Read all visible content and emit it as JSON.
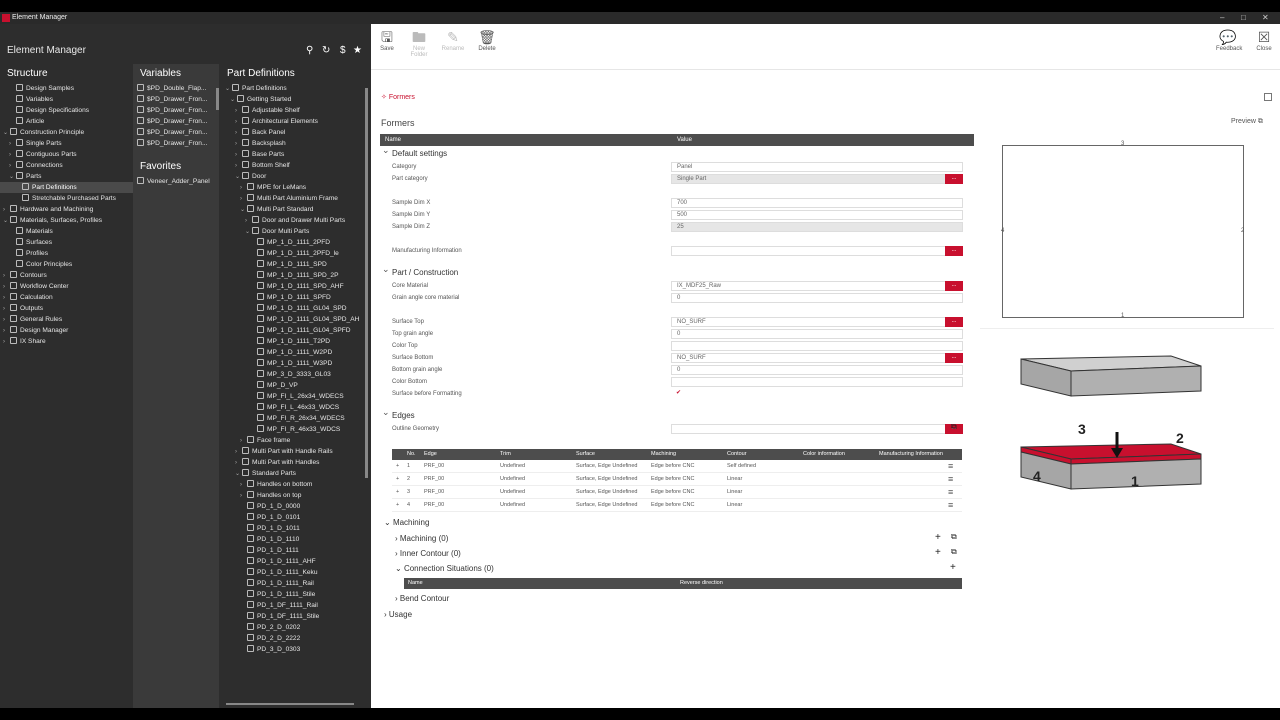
{
  "window": {
    "title": "Element Manager"
  },
  "app": {
    "title": "Element Manager"
  },
  "structure": {
    "title": "Structure",
    "items": [
      {
        "label": "Design Samples",
        "indent": 1,
        "exp": ""
      },
      {
        "label": "Variables",
        "indent": 1,
        "exp": ""
      },
      {
        "label": "Design Specifications",
        "indent": 1,
        "exp": ""
      },
      {
        "label": "Article",
        "indent": 1,
        "exp": ""
      },
      {
        "label": "Construction Principle",
        "indent": 0,
        "exp": "⌄"
      },
      {
        "label": "Single Parts",
        "indent": 1,
        "exp": "›"
      },
      {
        "label": "Contiguous Parts",
        "indent": 1,
        "exp": "›"
      },
      {
        "label": "Connections",
        "indent": 1,
        "exp": "›"
      },
      {
        "label": "Parts",
        "indent": 1,
        "exp": "⌄"
      },
      {
        "label": "Part Definitions",
        "indent": 2,
        "exp": "",
        "selected": true
      },
      {
        "label": "Stretchable Purchased Parts",
        "indent": 2,
        "exp": ""
      },
      {
        "label": "Hardware and Machining",
        "indent": 0,
        "exp": "›"
      },
      {
        "label": "Materials, Surfaces, Profiles",
        "indent": 0,
        "exp": "⌄"
      },
      {
        "label": "Materials",
        "indent": 1,
        "exp": ""
      },
      {
        "label": "Surfaces",
        "indent": 1,
        "exp": ""
      },
      {
        "label": "Profiles",
        "indent": 1,
        "exp": ""
      },
      {
        "label": "Color Principles",
        "indent": 1,
        "exp": ""
      },
      {
        "label": "Contours",
        "indent": 0,
        "exp": "›"
      },
      {
        "label": "Workflow Center",
        "indent": 0,
        "exp": "›"
      },
      {
        "label": "Calculation",
        "indent": 0,
        "exp": "›"
      },
      {
        "label": "Outputs",
        "indent": 0,
        "exp": "›"
      },
      {
        "label": "General Rules",
        "indent": 0,
        "exp": "›"
      },
      {
        "label": "Design Manager",
        "indent": 0,
        "exp": "›"
      },
      {
        "label": "IX Share",
        "indent": 0,
        "exp": "›"
      }
    ]
  },
  "variables": {
    "title": "Variables",
    "items": [
      "$PD_Double_Flap...",
      "$PD_Drawer_Fron...",
      "$PD_Drawer_Fron...",
      "$PD_Drawer_Fron...",
      "$PD_Drawer_Fron...",
      "$PD_Drawer_Fron..."
    ]
  },
  "favorites": {
    "title": "Favorites",
    "items": [
      "Veneer_Adder_Panel"
    ]
  },
  "partdefs": {
    "title": "Part Definitions",
    "items": [
      {
        "label": "Part Definitions",
        "indent": 0,
        "exp": "⌄"
      },
      {
        "label": "Getting Started",
        "indent": 1,
        "exp": "⌄"
      },
      {
        "label": "Adjustable Shelf",
        "indent": 2,
        "exp": "›"
      },
      {
        "label": "Architectural Elements",
        "indent": 2,
        "exp": "›"
      },
      {
        "label": "Back Panel",
        "indent": 2,
        "exp": "›"
      },
      {
        "label": "Backsplash",
        "indent": 2,
        "exp": "›"
      },
      {
        "label": "Base Parts",
        "indent": 2,
        "exp": "›"
      },
      {
        "label": "Bottom Shelf",
        "indent": 2,
        "exp": "›"
      },
      {
        "label": "Door",
        "indent": 2,
        "exp": "⌄"
      },
      {
        "label": "MPE for LeMans",
        "indent": 3,
        "exp": "›"
      },
      {
        "label": "Multi Part Aluminium Frame",
        "indent": 3,
        "exp": "›"
      },
      {
        "label": "Multi Part Standard",
        "indent": 3,
        "exp": "⌄"
      },
      {
        "label": "Door and Drawer Multi Parts",
        "indent": 4,
        "exp": "›"
      },
      {
        "label": "Door Multi Parts",
        "indent": 4,
        "exp": "⌄"
      },
      {
        "label": "MP_1_D_1111_2PFD",
        "indent": 5,
        "exp": ""
      },
      {
        "label": "MP_1_D_1111_2PFD_le",
        "indent": 5,
        "exp": ""
      },
      {
        "label": "MP_1_D_1111_SPD",
        "indent": 5,
        "exp": ""
      },
      {
        "label": "MP_1_D_1111_SPD_2P",
        "indent": 5,
        "exp": ""
      },
      {
        "label": "MP_1_D_1111_SPD_AHF",
        "indent": 5,
        "exp": ""
      },
      {
        "label": "MP_1_D_1111_SPFD",
        "indent": 5,
        "exp": ""
      },
      {
        "label": "MP_1_D_1111_GL04_SPD",
        "indent": 5,
        "exp": ""
      },
      {
        "label": "MP_1_D_1111_GL04_SPD_AH",
        "indent": 5,
        "exp": ""
      },
      {
        "label": "MP_1_D_1111_GL04_SPFD",
        "indent": 5,
        "exp": ""
      },
      {
        "label": "MP_1_D_1111_T2PD",
        "indent": 5,
        "exp": ""
      },
      {
        "label": "MP_1_D_1111_W2PD",
        "indent": 5,
        "exp": ""
      },
      {
        "label": "MP_1_D_1111_W3PD",
        "indent": 5,
        "exp": ""
      },
      {
        "label": "MP_3_D_3333_GL03",
        "indent": 5,
        "exp": ""
      },
      {
        "label": "MP_D_VP",
        "indent": 5,
        "exp": ""
      },
      {
        "label": "MP_FI_L_26x34_WDECS",
        "indent": 5,
        "exp": ""
      },
      {
        "label": "MP_FI_L_46x33_WDCS",
        "indent": 5,
        "exp": ""
      },
      {
        "label": "MP_FI_R_26x34_WDECS",
        "indent": 5,
        "exp": ""
      },
      {
        "label": "MP_FI_R_46x33_WDCS",
        "indent": 5,
        "exp": ""
      },
      {
        "label": "Face frame",
        "indent": 3,
        "exp": "›"
      },
      {
        "label": "Multi Part with Handle Rails",
        "indent": 2,
        "exp": "›"
      },
      {
        "label": "Multi Part with Handles",
        "indent": 2,
        "exp": "›"
      },
      {
        "label": "Standard Parts",
        "indent": 2,
        "exp": "⌄"
      },
      {
        "label": "Handles on bottom",
        "indent": 3,
        "exp": "›"
      },
      {
        "label": "Handles on top",
        "indent": 3,
        "exp": "›"
      },
      {
        "label": "PD_1_D_0000",
        "indent": 3,
        "exp": ""
      },
      {
        "label": "PD_1_D_0101",
        "indent": 3,
        "exp": ""
      },
      {
        "label": "PD_1_D_1011",
        "indent": 3,
        "exp": ""
      },
      {
        "label": "PD_1_D_1110",
        "indent": 3,
        "exp": ""
      },
      {
        "label": "PD_1_D_1111",
        "indent": 3,
        "exp": ""
      },
      {
        "label": "PD_1_D_1111_AHF",
        "indent": 3,
        "exp": ""
      },
      {
        "label": "PD_1_D_1111_Keku",
        "indent": 3,
        "exp": ""
      },
      {
        "label": "PD_1_D_1111_Rail",
        "indent": 3,
        "exp": ""
      },
      {
        "label": "PD_1_D_1111_Stile",
        "indent": 3,
        "exp": ""
      },
      {
        "label": "PD_1_DF_1111_Rail",
        "indent": 3,
        "exp": ""
      },
      {
        "label": "PD_1_DF_1111_Stile",
        "indent": 3,
        "exp": ""
      },
      {
        "label": "PD_2_D_0202",
        "indent": 3,
        "exp": ""
      },
      {
        "label": "PD_2_D_2222",
        "indent": 3,
        "exp": ""
      },
      {
        "label": "PD_3_D_0303",
        "indent": 3,
        "exp": ""
      }
    ]
  },
  "toolbar": {
    "save": "Save",
    "new_folder": "New Folder",
    "rename": "Rename",
    "delete": "Delete",
    "feedback": "Feedback",
    "close": "Close"
  },
  "breadcrumb": "Formers",
  "page_title": "Formers",
  "preview_label": "Preview",
  "grid": {
    "name_col": "Name",
    "value_col": "Value"
  },
  "sections": {
    "default": "Default settings",
    "part": "Part / Construction",
    "edges": "Edges",
    "machining": "Machining",
    "usage": "Usage"
  },
  "props": {
    "category": {
      "k": "Category",
      "v": "Panel"
    },
    "part_category": {
      "k": "Part category",
      "v": "Single Part"
    },
    "dimx": {
      "k": "Sample Dim X",
      "v": "700"
    },
    "dimy": {
      "k": "Sample Dim Y",
      "v": "500"
    },
    "dimz": {
      "k": "Sample Dim Z",
      "v": "25"
    },
    "mfg": {
      "k": "Manufacturing Information",
      "v": ""
    },
    "core": {
      "k": "Core Material",
      "v": "IX_MDF25_Raw"
    },
    "grain_core": {
      "k": "Grain angle core material",
      "v": "0"
    },
    "surf_top": {
      "k": "Surface Top",
      "v": "NO_SURF"
    },
    "top_grain": {
      "k": "Top grain angle",
      "v": "0"
    },
    "color_top": {
      "k": "Color Top",
      "v": ""
    },
    "surf_bottom": {
      "k": "Surface Bottom",
      "v": "NO_SURF"
    },
    "bottom_grain": {
      "k": "Bottom grain angle",
      "v": "0"
    },
    "color_bottom": {
      "k": "Color Bottom",
      "v": ""
    },
    "surf_before": {
      "k": "Surface before Formatting",
      "v": "✔"
    },
    "outline": {
      "k": "Outline Geometry",
      "v": ""
    }
  },
  "edge_table": {
    "headers": [
      "No.",
      "Edge",
      "Trim",
      "Surface",
      "Machining",
      "Contour",
      "Color information",
      "Manufacturing Information"
    ],
    "rows": [
      [
        "1",
        "PRF_00",
        "Undefined",
        "Surface, Edge Undefined",
        "Edge before CNC",
        "Self defined"
      ],
      [
        "2",
        "PRF_00",
        "Undefined",
        "Surface, Edge Undefined",
        "Edge before CNC",
        "Linear"
      ],
      [
        "3",
        "PRF_00",
        "Undefined",
        "Surface, Edge Undefined",
        "Edge before CNC",
        "Linear"
      ],
      [
        "4",
        "PRF_00",
        "Undefined",
        "Surface, Edge Undefined",
        "Edge before CNC",
        "Linear"
      ]
    ]
  },
  "machining": {
    "machining": "Machining (0)",
    "inner": "Inner Contour (0)",
    "conn": "Connection Situations (0)",
    "conn_headers": [
      "Name",
      "Reverse direction"
    ],
    "bend": "Bend Contour"
  },
  "preview_numbers": {
    "top": "3",
    "left": "4",
    "right": "2",
    "bottom": "1"
  },
  "diagram_numbers": [
    "3",
    "2",
    "4",
    "1"
  ],
  "colors": {
    "accent": "#c8102e",
    "panel": "#2d2d2d",
    "box_gray": "#b0b0b0"
  }
}
